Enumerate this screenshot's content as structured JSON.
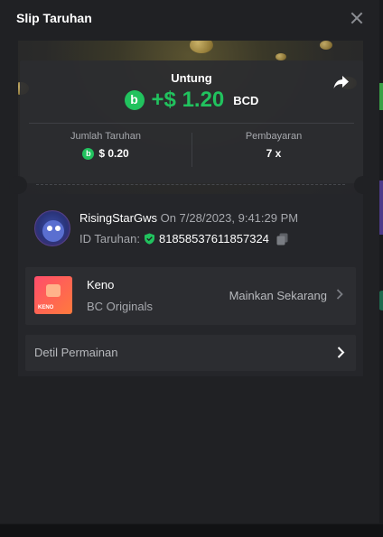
{
  "modal": {
    "title": "Slip Taruhan"
  },
  "profit": {
    "label": "Untung",
    "amount": "+$ 1.20",
    "currency": "BCD"
  },
  "stats": {
    "bet_label": "Jumlah Taruhan",
    "bet_value": "$ 0.20",
    "payout_label": "Pembayaran",
    "payout_value": "7 x"
  },
  "bet_info": {
    "username": "RisingStarGws",
    "date": "On 7/28/2023, 9:41:29 PM",
    "id_label": "ID Taruhan:",
    "id_value": "81858537611857324"
  },
  "game": {
    "name": "Keno",
    "provider": "BC Originals",
    "thumb_text": "KENO",
    "play_label": "Mainkan Sekarang"
  },
  "details": {
    "label": "Detil Permainan"
  },
  "colors": {
    "accent_green": "#21c25e",
    "panel": "#25262a",
    "modal_bg": "#202124"
  },
  "icons": {
    "close": "close-icon",
    "share": "share-icon",
    "coin": "bcd-coin-icon",
    "shield": "shield-check-icon",
    "copy": "copy-icon",
    "chevron": "chevron-right-icon"
  }
}
